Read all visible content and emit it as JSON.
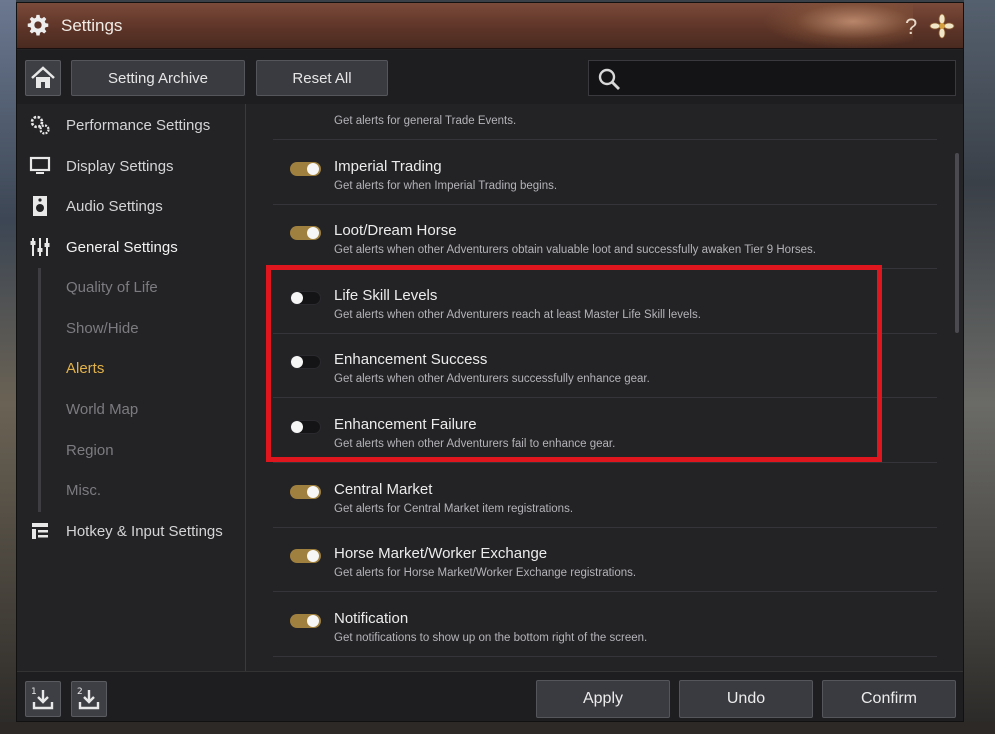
{
  "window": {
    "title": "Settings",
    "help_label": "?"
  },
  "toolbar": {
    "setting_archive_label": "Setting Archive",
    "reset_all_label": "Reset All",
    "search_placeholder": ""
  },
  "sidebar": {
    "items": [
      {
        "label": "Performance Settings",
        "icon": "performance-gears-icon"
      },
      {
        "label": "Display Settings",
        "icon": "monitor-icon"
      },
      {
        "label": "Audio Settings",
        "icon": "speaker-icon"
      },
      {
        "label": "General Settings",
        "icon": "sliders-icon"
      },
      {
        "label": "Hotkey & Input Settings",
        "icon": "keyboard-icon"
      }
    ],
    "sub_items": [
      {
        "label": "Quality of Life",
        "active": false
      },
      {
        "label": "Show/Hide",
        "active": false
      },
      {
        "label": "Alerts",
        "active": true
      },
      {
        "label": "World Map",
        "active": false
      },
      {
        "label": "Region",
        "active": false
      },
      {
        "label": "Misc.",
        "active": false
      }
    ]
  },
  "alerts": [
    {
      "title": "",
      "desc": "Get alerts for general Trade Events.",
      "on": true
    },
    {
      "title": "Imperial Trading",
      "desc": "Get alerts for when Imperial Trading begins.",
      "on": true
    },
    {
      "title": "Loot/Dream Horse",
      "desc": "Get alerts when other Adventurers obtain valuable loot and successfully awaken Tier 9 Horses.",
      "on": true
    },
    {
      "title": "Life Skill Levels",
      "desc": "Get alerts when other Adventurers reach at least Master Life Skill levels.",
      "on": false
    },
    {
      "title": "Enhancement Success",
      "desc": "Get alerts when other Adventurers successfully enhance gear.",
      "on": false
    },
    {
      "title": "Enhancement Failure",
      "desc": "Get alerts when other Adventurers fail to enhance gear.",
      "on": false
    },
    {
      "title": "Central Market",
      "desc": "Get alerts for Central Market item registrations.",
      "on": true
    },
    {
      "title": "Horse Market/Worker Exchange",
      "desc": "Get alerts for Horse Market/Worker Exchange registrations.",
      "on": true
    },
    {
      "title": "Notification",
      "desc": "Get notifications to show up on the bottom right of the screen.",
      "on": true
    }
  ],
  "bottom": {
    "download_1_label": "1",
    "download_2_label": "2",
    "apply_label": "Apply",
    "undo_label": "Undo",
    "confirm_label": "Confirm"
  },
  "colors": {
    "accent_gold": "#e2b24a",
    "toggle_on": "#a0803e",
    "highlight_red": "#e0161e"
  }
}
